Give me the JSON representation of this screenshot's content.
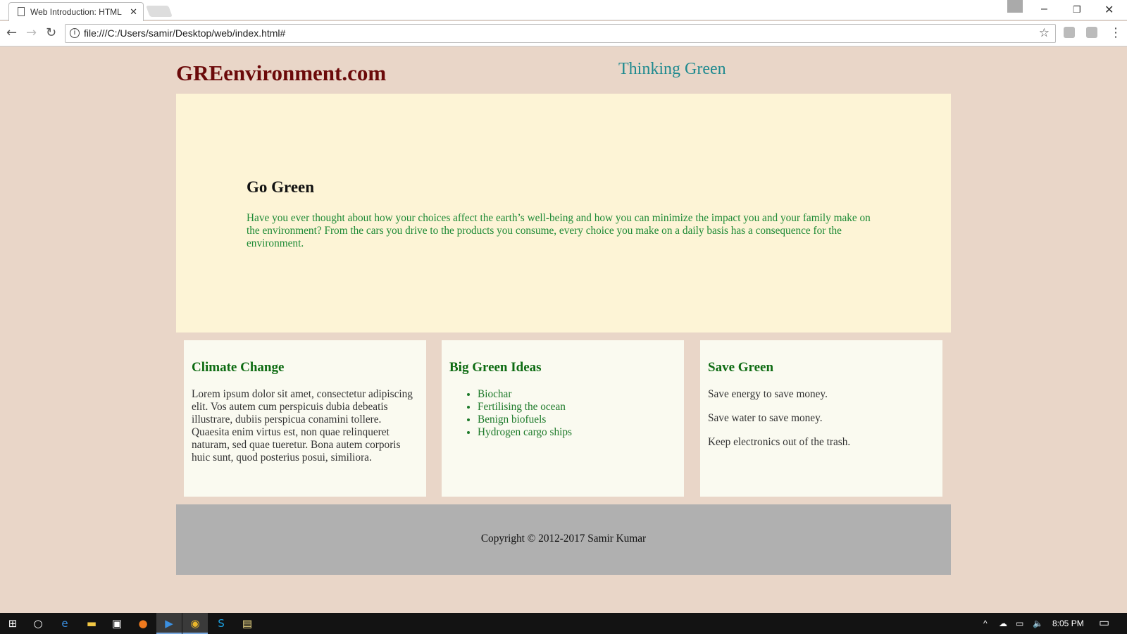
{
  "browser": {
    "tab_title": "Web Introduction: HTML",
    "url": "file:///C:/Users/samir/Desktop/web/index.html#"
  },
  "header": {
    "site_title": "GREenvironment.com",
    "tagline": "Thinking Green"
  },
  "hero": {
    "heading": "Go Green",
    "text": "Have you ever thought about how your choices affect the earth’s well-being and how you can minimize the impact you and your family make on the environment? From the cars you drive to the products you consume, every choice you make on a daily basis has a consequence for the environment."
  },
  "cards": [
    {
      "heading": "Climate Change",
      "text": "Lorem ipsum dolor sit amet, consectetur adipiscing elit. Vos autem cum perspicuis dubia debeatis illustrare, dubiis perspicua conamini tollere. Quaesita enim virtus est, non quae relinqueret naturam, sed quae tueretur. Bona autem corporis huic sunt, quod posterius posui, similiora."
    },
    {
      "heading": "Big Green Ideas",
      "items": [
        "Biochar",
        "Fertilising the ocean",
        "Benign biofuels",
        "Hydrogen cargo ships"
      ]
    },
    {
      "heading": "Save Green",
      "paragraphs": [
        "Save energy to save money.",
        "Save water to save money.",
        "Keep electronics out of the trash."
      ]
    }
  ],
  "footer": {
    "text": "Copyright © 2012-2017 Samir Kumar"
  },
  "taskbar": {
    "time": "8:05 PM"
  }
}
